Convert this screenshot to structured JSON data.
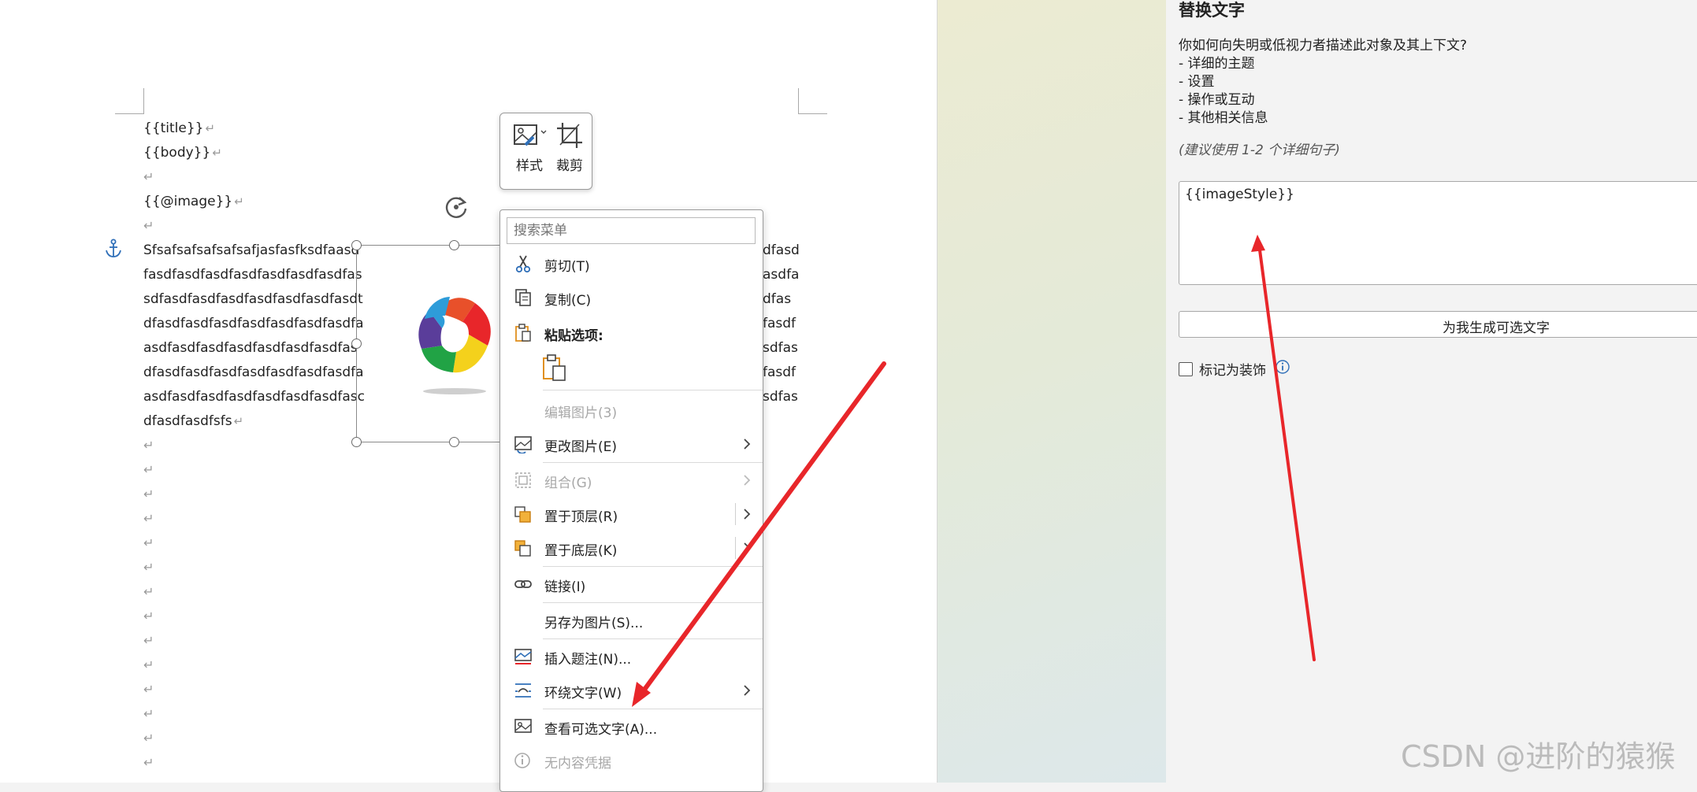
{
  "document": {
    "lines": [
      "{{title}}",
      "{{body}}",
      "",
      "{{@image}}",
      ""
    ],
    "paragraph_left": [
      "Sfsafsafsafsafsafjasfasfksdfaasd",
      "fasdfasdfasdfasdfasdfasdfasdfas",
      "sdfasdfasdfasdfasdfasdfasdfasdt",
      "dfasdfasdfasdfasdfasdfasdfasdfa",
      "asdfasdfasdfasdfasdfasdfasdfas",
      "dfasdfasdfasdfasdfasdfasdfasdfa",
      "asdfasdfasdfasdfasdfasdfasdfasc",
      "dfasdfasdfsfs"
    ],
    "paragraph_right": [
      "dfasd",
      "asdfa",
      "dfas",
      "fasdf",
      "sdfas",
      "fasdf",
      "sdfas"
    ],
    "paragraph_mark": "↵"
  },
  "mini_toolbar": {
    "style_label": "样式",
    "crop_label": "裁剪"
  },
  "context_menu": {
    "search_placeholder": "搜索菜单",
    "items": {
      "cut": "剪切(T)",
      "copy": "复制(C)",
      "paste_options": "粘贴选项:",
      "edit_picture": "编辑图片(3)",
      "change_picture": "更改图片(E)",
      "group": "组合(G)",
      "bring_front": "置于顶层(R)",
      "send_back": "置于底层(K)",
      "link": "链接(I)",
      "save_as_picture": "另存为图片(S)...",
      "insert_caption": "插入题注(N)...",
      "wrap_text": "环绕文字(W)",
      "view_alt_text": "查看可选文字(A)...",
      "no_credentials": "无内容凭据"
    }
  },
  "alt_text_panel": {
    "title": "替换文字",
    "question": "你如何向失明或低视力者描述此对象及其上下文?",
    "bullets": [
      "- 详细的主题",
      "- 设置",
      "- 操作或互动",
      "- 其他相关信息"
    ],
    "hint": "(建议使用 1-2 个详细句子)",
    "textarea_value": "{{imageStyle}}",
    "generate_button": "为我生成可选文字",
    "decorative_label": "标记为装饰",
    "decorative_checked": false
  },
  "watermark": "CSDN @进阶的猿猴",
  "colors": {
    "annotation_arrow": "#e8262a",
    "anchor": "#2f6fb8",
    "menu_icon_blue": "#2f6fb8",
    "menu_icon_orange": "#e0901f"
  }
}
